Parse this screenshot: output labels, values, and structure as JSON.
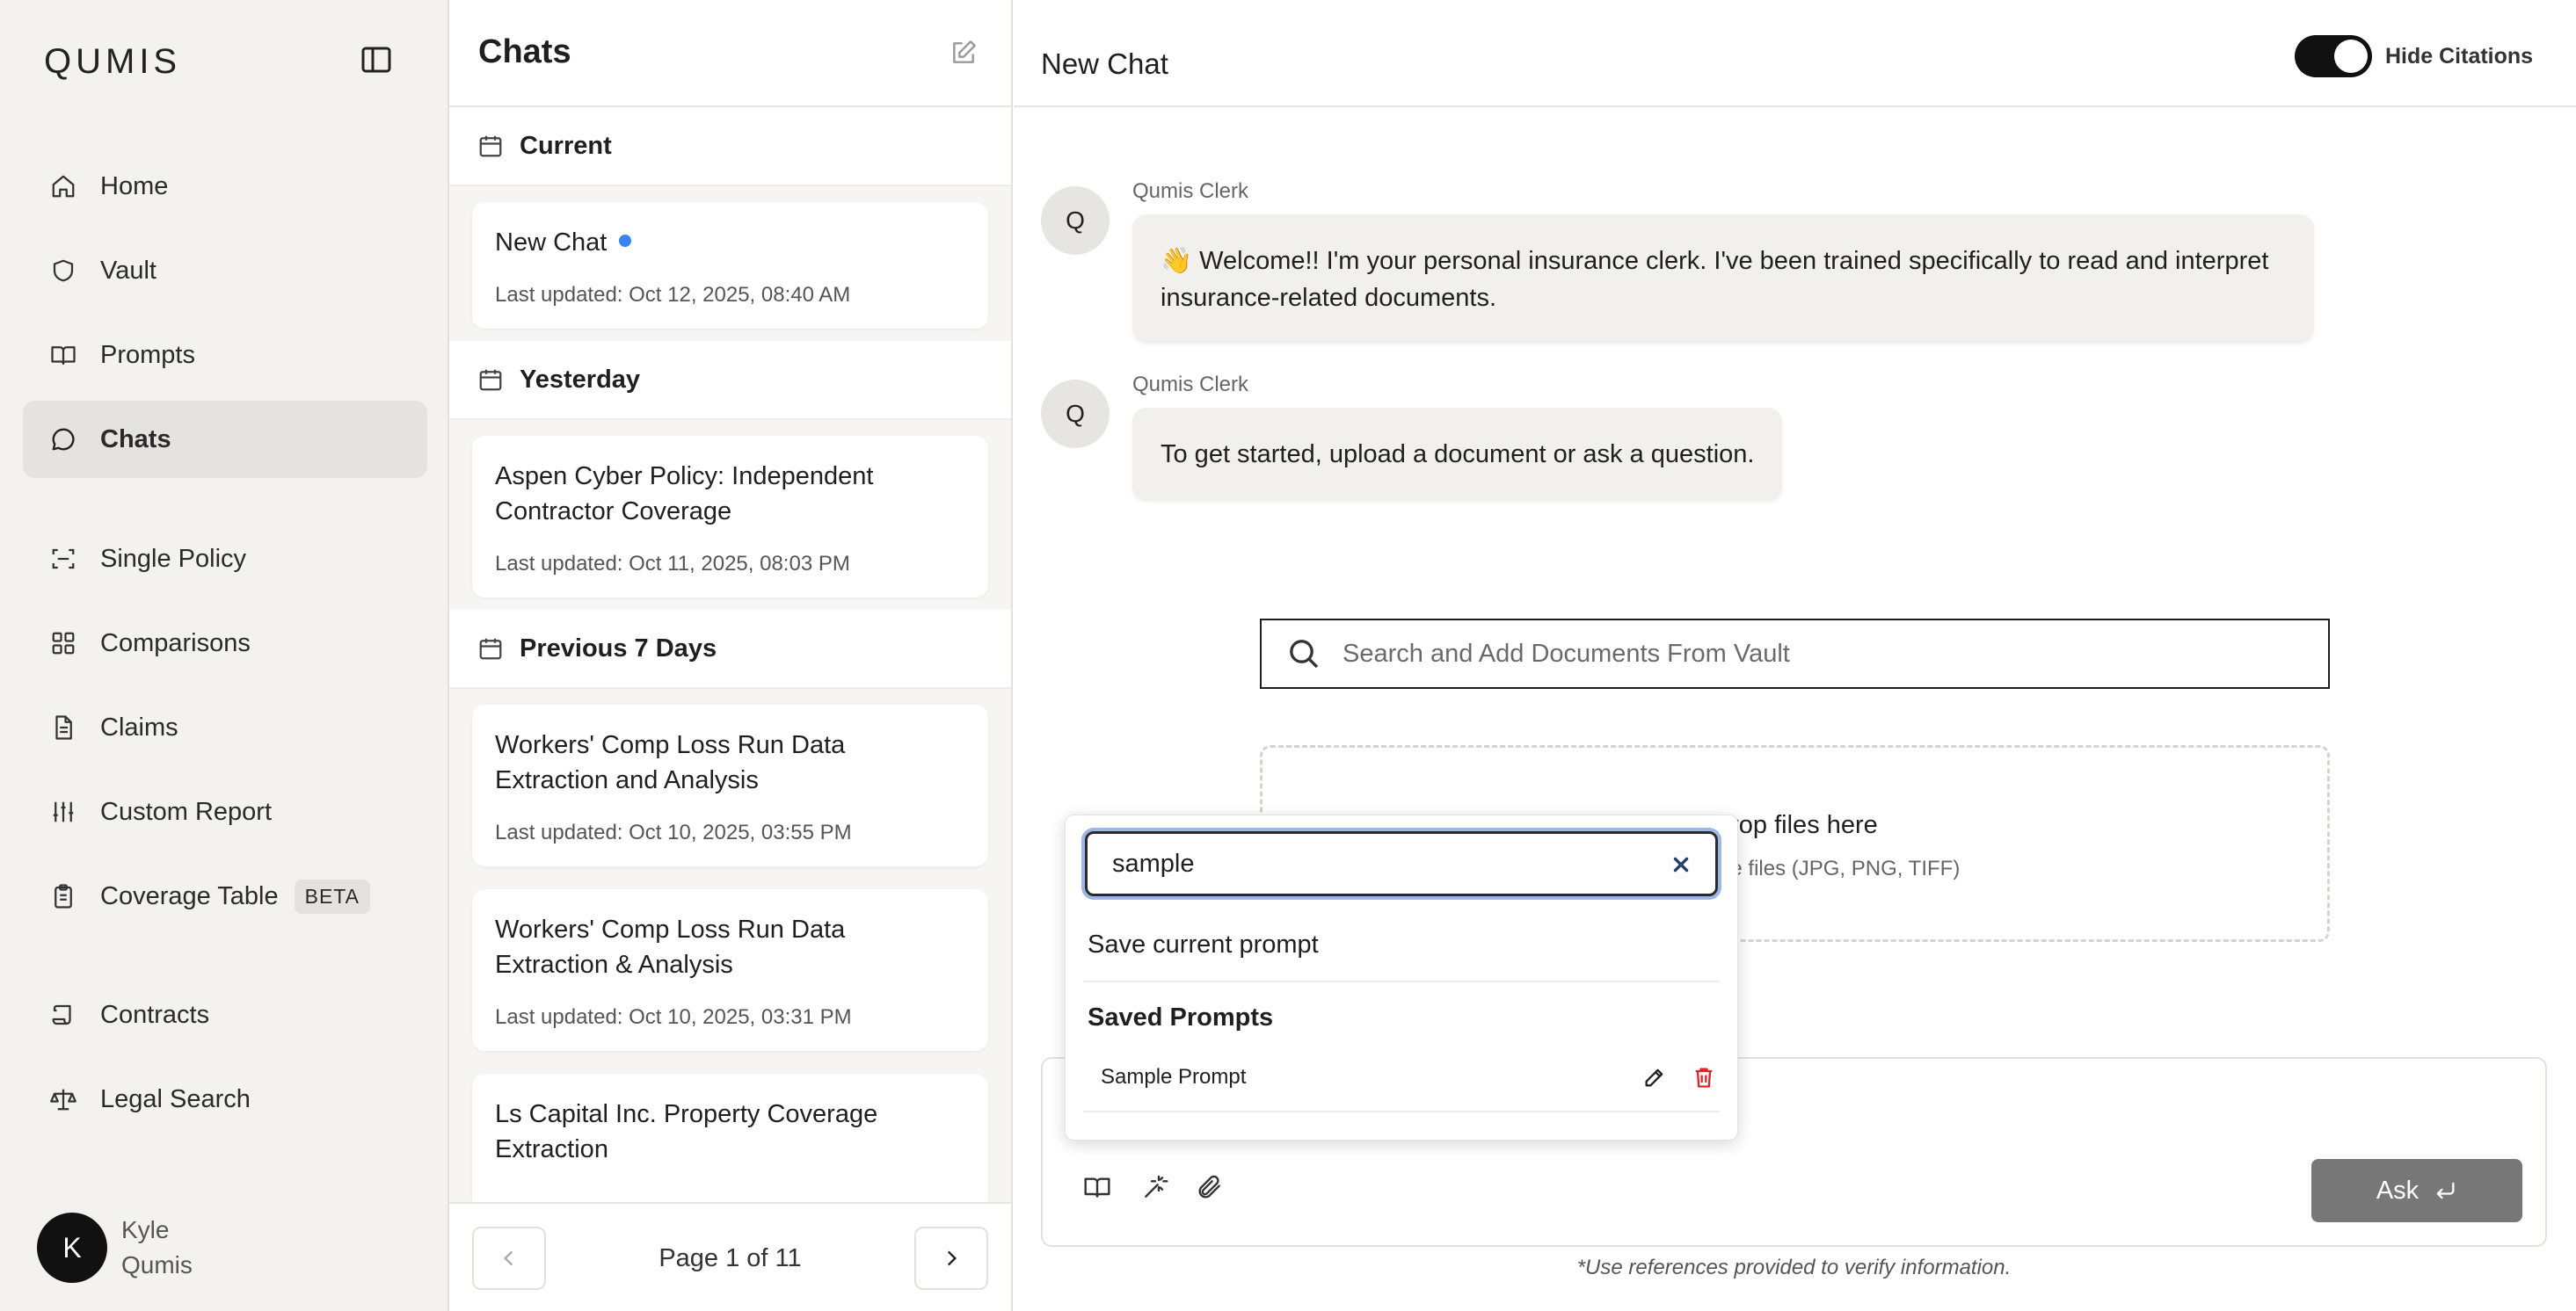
{
  "sidebar": {
    "logo": "QUMIS",
    "nav_primary": [
      {
        "label": "Home",
        "icon": "home-icon"
      },
      {
        "label": "Vault",
        "icon": "shield-icon"
      },
      {
        "label": "Prompts",
        "icon": "book-icon"
      },
      {
        "label": "Chats",
        "icon": "chat-bubble-icon",
        "active": true
      }
    ],
    "nav_tools": [
      {
        "label": "Single Policy",
        "icon": "scan-icon"
      },
      {
        "label": "Comparisons",
        "icon": "grid-icon"
      },
      {
        "label": "Claims",
        "icon": "document-icon"
      },
      {
        "label": "Custom Report",
        "icon": "sliders-icon"
      },
      {
        "label": "Coverage Table",
        "icon": "clipboard-icon",
        "badge": "BETA"
      }
    ],
    "nav_legal": [
      {
        "label": "Contracts",
        "icon": "scroll-icon"
      },
      {
        "label": "Legal Search",
        "icon": "scale-icon"
      }
    ],
    "user": {
      "initial": "K",
      "first_name": "Kyle",
      "last_name": "Qumis"
    }
  },
  "chats": {
    "title": "Chats",
    "groups": [
      {
        "label": "Current",
        "items": [
          {
            "title": "New Chat",
            "date": "Last updated: Oct 12, 2025, 08:40 AM",
            "unread": true
          }
        ]
      },
      {
        "label": "Yesterday",
        "items": [
          {
            "title": "Aspen Cyber Policy: Independent Contractor Coverage",
            "date": "Last updated: Oct 11, 2025, 08:03 PM"
          }
        ]
      },
      {
        "label": "Previous 7 Days",
        "items": [
          {
            "title": "Workers' Comp Loss Run Data Extraction and Analysis",
            "date": "Last updated: Oct 10, 2025, 03:55 PM"
          },
          {
            "title": "Workers' Comp Loss Run Data Extraction & Analysis",
            "date": "Last updated: Oct 10, 2025, 03:31 PM"
          },
          {
            "title": "Ls Capital Inc. Property Coverage Extraction",
            "date": ""
          }
        ]
      }
    ],
    "pagination": "Page 1 of 11"
  },
  "main": {
    "title": "New Chat",
    "toggle_label": "Hide Citations",
    "toggle_on": true,
    "messages": [
      {
        "avatar": "Q",
        "sender": "Qumis Clerk",
        "line1": "👋 Welcome!! I'm your personal insurance clerk. I've been trained specifically to read and interpret",
        "line2": "insurance-related documents."
      },
      {
        "avatar": "Q",
        "sender": "Qumis Clerk",
        "line1": "To get started, upload a document or ask a question."
      }
    ],
    "vault_search_placeholder": "Search and Add Documents From Vault",
    "dropzone": {
      "title_visible": "Drop files here",
      "subtitle_visible": "rd, or image files (JPG, PNG, TIFF)"
    },
    "ask_label": "Ask",
    "footnote": "*Use references provided to verify information."
  },
  "prompt_popover": {
    "search_value": "sample",
    "save_current": "Save current prompt",
    "saved_heading": "Saved Prompts",
    "saved_items": [
      {
        "label": "Sample Prompt"
      }
    ]
  },
  "colors": {
    "accent_dot": "#3b82f6",
    "delete_red": "#dc2626",
    "focus_ring": "#9db6e6"
  }
}
